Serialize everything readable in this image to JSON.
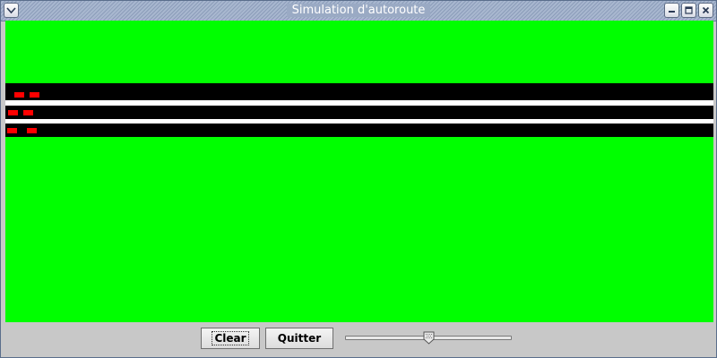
{
  "window": {
    "title": "Simulation d'autoroute"
  },
  "titlebar": {
    "menu_icon": "chevron-down-icon",
    "minimize_icon": "minimize-icon",
    "maximize_icon": "maximize-icon",
    "close_icon": "close-icon"
  },
  "simulation": {
    "background_color": "#00ff00",
    "road_color": "#000000",
    "lane_separator_color": "#ffffff",
    "car_color": "#ff0000",
    "lanes": [
      {
        "cars_count": 2
      },
      {
        "cars_count": 2
      },
      {
        "cars_count": 2
      }
    ]
  },
  "controls": {
    "clear_label": "Clear",
    "quit_label": "Quitter",
    "speed_slider": {
      "value": 0.5
    }
  }
}
